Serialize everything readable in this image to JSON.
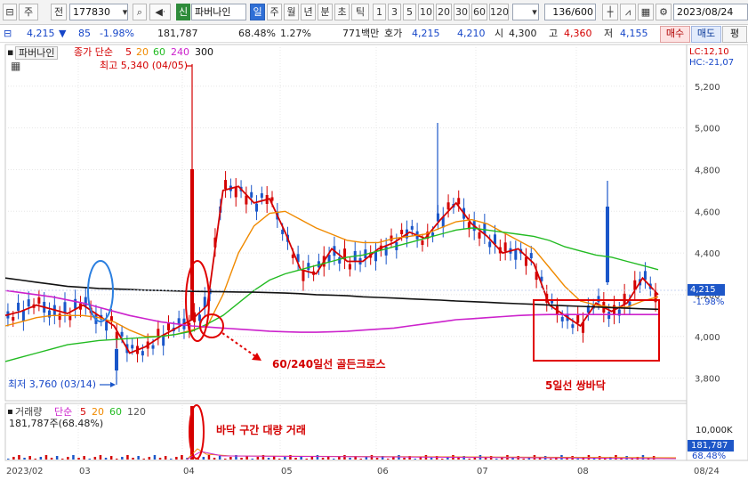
{
  "toolbar": {
    "market": "주",
    "period_prefix": "전",
    "code": "177830",
    "market_badge": "신",
    "name": "파버나인",
    "periods": [
      "일",
      "주",
      "월",
      "년",
      "분",
      "초",
      "틱"
    ],
    "active_period": "일",
    "intervals": [
      "1",
      "3",
      "5",
      "10",
      "20",
      "30",
      "60",
      "120"
    ],
    "count": "136/600",
    "date": "2023/08/24"
  },
  "info": {
    "price": "4,215",
    "change": "85",
    "change_pct": "-1.98%",
    "volume": "181,787",
    "vol_ratio": "68.48%",
    "turnover": "1.27%",
    "amount_label": "771백만",
    "quote_label": "호가",
    "ask": "4,215",
    "bid": "4,210",
    "open_label": "시",
    "open": "4,300",
    "high_label": "고",
    "high": "4,360",
    "low_label": "저",
    "low": "4,155",
    "buy": "매수",
    "sell": "매도",
    "eval": "평"
  },
  "price_pane": {
    "tab": "파버나인",
    "legend_label": "종가 단순",
    "ma_periods": [
      "5",
      "20",
      "60",
      "240",
      "300"
    ],
    "lc": "LC:12,10",
    "hc": "HC:-21,07",
    "high_note": "최고 5,340 (04/05)",
    "low_note": "최저 3,760 (03/14)",
    "current_price": "4,215",
    "current_pct": "-1.98%"
  },
  "volume_pane": {
    "legend_label": "거래량",
    "legend_simple": "단순",
    "ma_periods": [
      "5",
      "20",
      "60",
      "120"
    ],
    "value_line": "181,787주(68.48%)",
    "current": "181,787",
    "current_pct": "68.48%"
  },
  "annotations": {
    "golden_cross": "60/240일선 골든크로스",
    "double_bottom": "5일선 쌍바닥",
    "bottom_volume": "바닥 구간 대량 거래"
  },
  "colors": {
    "up": "#d40000",
    "down": "#1a56c9",
    "ma5": "#d40000",
    "ma20": "#f08a00",
    "ma60": "#22bb22",
    "ma240": "#cc22cc",
    "ma300": "#111111"
  },
  "chart_data": {
    "type": "line",
    "title": "",
    "xlabel": "",
    "ylabel": "",
    "ylim": [
      3700,
      5340
    ],
    "y_ticks": [
      "5,200",
      "5,000",
      "4,800",
      "4,600",
      "4,400",
      "4,200",
      "4,000",
      "3,800"
    ],
    "x_ticks": [
      "2023/02",
      "03",
      "04",
      "05",
      "06",
      "07",
      "08",
      "08/24"
    ],
    "series": [
      {
        "name": "5",
        "values": [
          4100,
          4120,
          4150,
          4130,
          4110,
          4150,
          4100,
          4050,
          3920,
          3950,
          4000,
          4040,
          4080,
          4150,
          4700,
          4720,
          4640,
          4660,
          4500,
          4320,
          4300,
          4420,
          4360,
          4360,
          4420,
          4450,
          4500,
          4470,
          4560,
          4640,
          4540,
          4480,
          4400,
          4420,
          4350,
          4150,
          4100,
          4050,
          4160,
          4120,
          4160,
          4280,
          4200
        ]
      },
      {
        "name": "20",
        "values": [
          4050,
          4070,
          4090,
          4100,
          4100,
          4100,
          4090,
          4070,
          4030,
          4000,
          4000,
          4010,
          4030,
          4050,
          4200,
          4400,
          4530,
          4590,
          4600,
          4560,
          4520,
          4490,
          4460,
          4450,
          4450,
          4470,
          4480,
          4490,
          4520,
          4550,
          4560,
          4540,
          4500,
          4460,
          4420,
          4330,
          4240,
          4170,
          4150,
          4140,
          4140,
          4170,
          4190
        ]
      },
      {
        "name": "60",
        "values": [
          3880,
          3900,
          3920,
          3940,
          3960,
          3970,
          3980,
          3985,
          3990,
          3995,
          4000,
          4010,
          4025,
          4060,
          4100,
          4160,
          4220,
          4270,
          4300,
          4320,
          4340,
          4360,
          4380,
          4390,
          4410,
          4430,
          4450,
          4470,
          4490,
          4510,
          4520,
          4510,
          4500,
          4490,
          4480,
          4460,
          4430,
          4410,
          4390,
          4380,
          4360,
          4340,
          4320
        ]
      },
      {
        "name": "240",
        "values": [
          4220,
          4210,
          4200,
          4190,
          4175,
          4160,
          4140,
          4120,
          4100,
          4085,
          4070,
          4060,
          4050,
          4045,
          4040,
          4035,
          4030,
          4025,
          4022,
          4020,
          4020,
          4022,
          4025,
          4030,
          4035,
          4040,
          4050,
          4060,
          4070,
          4080,
          4085,
          4090,
          4095,
          4100,
          4103,
          4105,
          4105,
          4105,
          4105,
          4105,
          4105,
          4105,
          4105
        ]
      },
      {
        "name": "300",
        "values": [
          4280,
          4270,
          4260,
          4250,
          4240,
          4235,
          4230,
          4228,
          4225,
          4222,
          4220,
          4218,
          4216,
          4215,
          4214,
          4213,
          4212,
          4210,
          4208,
          4205,
          4200,
          4198,
          4195,
          4190,
          4187,
          4184,
          4180,
          4177,
          4174,
          4170,
          4167,
          4164,
          4160,
          4157,
          4154,
          4150,
          4147,
          4144,
          4141,
          4138,
          4135,
          4132,
          4130
        ]
      }
    ]
  }
}
